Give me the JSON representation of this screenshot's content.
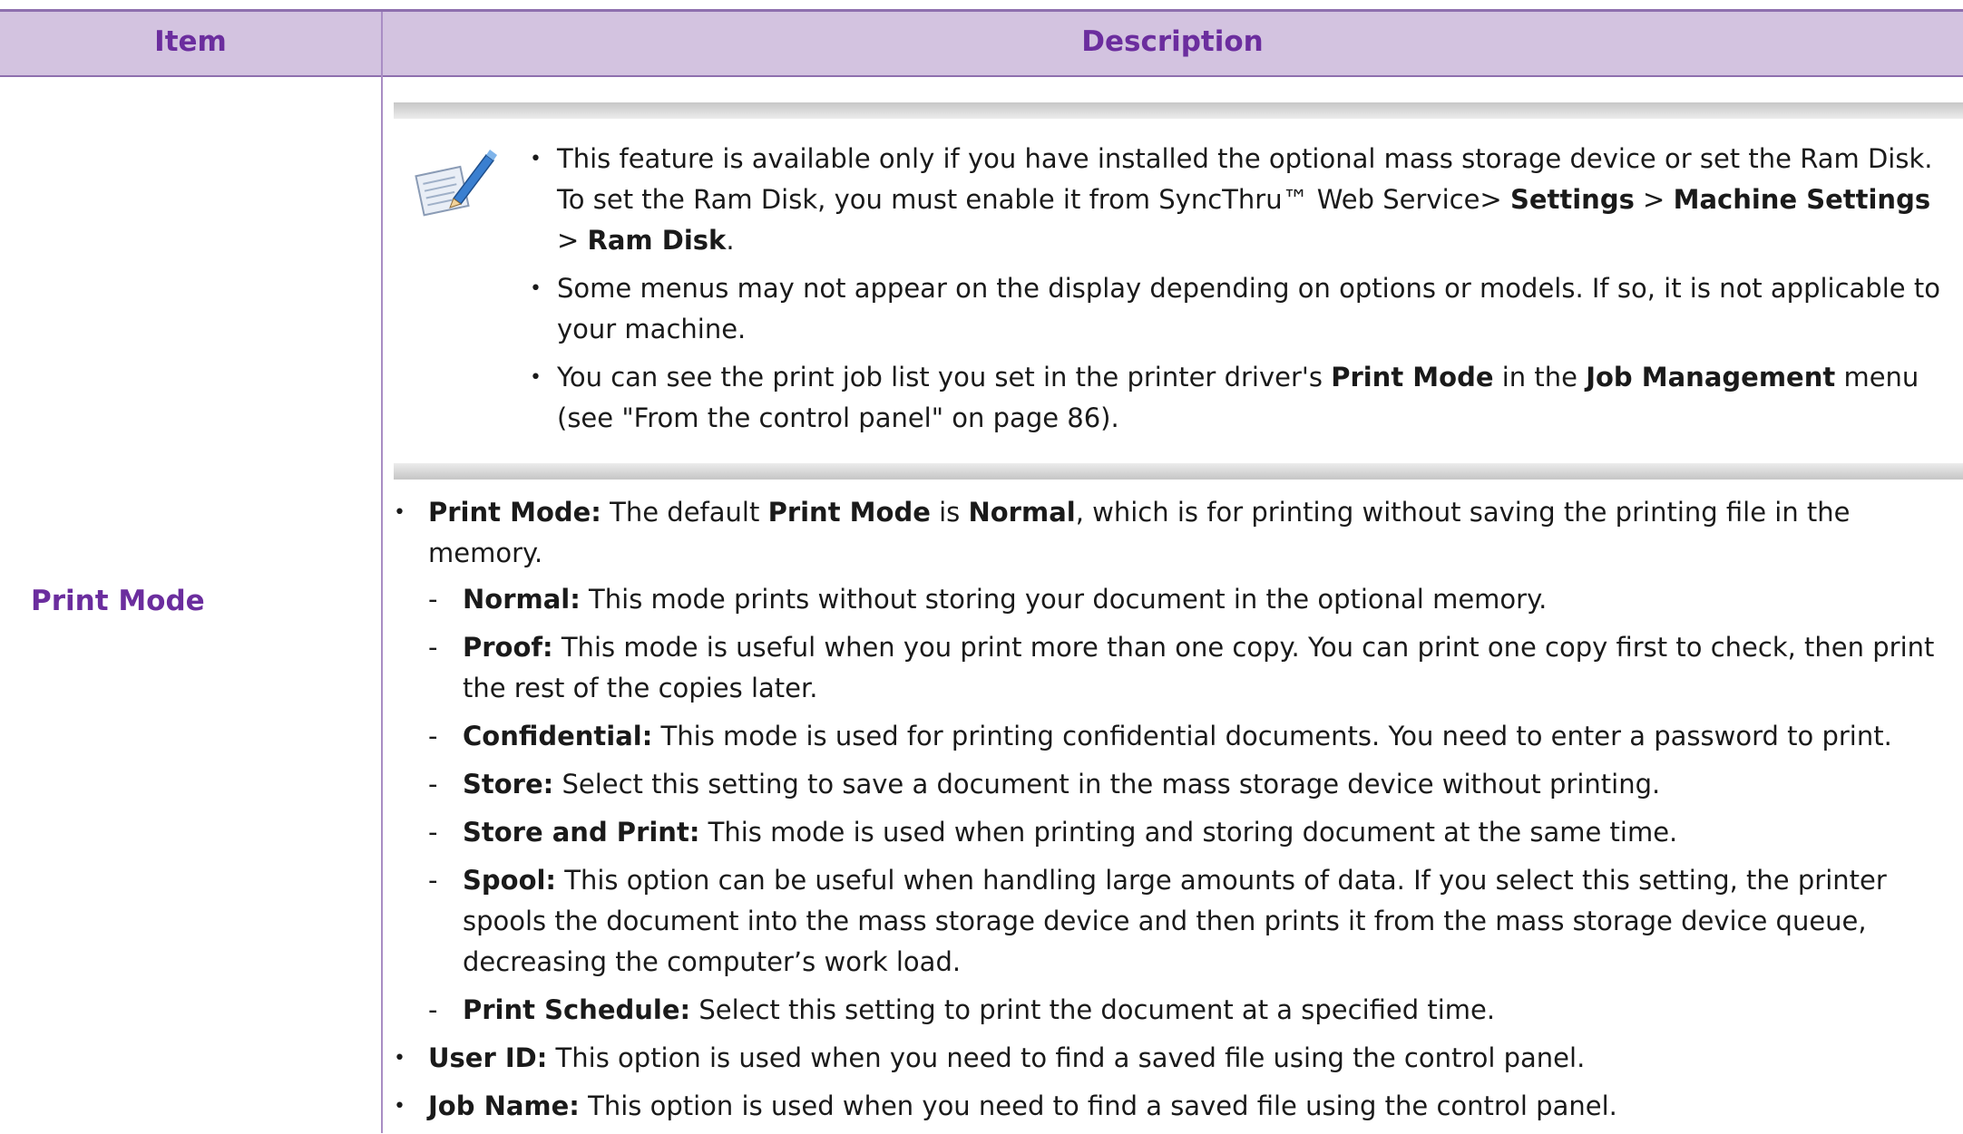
{
  "header": {
    "item": "Item",
    "description": "Description"
  },
  "row": {
    "item_label": "Print Mode"
  },
  "note": {
    "icon": "note-pencil-icon",
    "items": [
      {
        "t1": " This feature is available only if you have installed the optional mass storage device or set the Ram Disk. To set the Ram Disk, you must enable it from SyncThru™ Web Service",
        "sep1": "> ",
        "b1": "Settings",
        "sep2": " > ",
        "b2": "Machine Settings",
        "sep3": " > ",
        "b3": "Ram Disk",
        "t2": "."
      },
      {
        "t1": "Some menus may not appear on the display depending on options or models. If so, it is not applicable to your machine."
      },
      {
        "t1": "You can see the print job list you set in the printer driver's ",
        "b1": "Print Mode",
        "t2": " in the ",
        "b2": "Job Management",
        "t3": " menu (see \"From the control panel\" on page 86)."
      }
    ]
  },
  "main": {
    "print_mode": {
      "b1": "Print Mode:",
      "t1": " The default ",
      "b2": "Print Mode",
      "t2": " is ",
      "b3": "Normal",
      "t3": ", which is for printing without saving the printing file in the memory."
    },
    "sub": [
      {
        "b": "Normal:",
        "t": " This mode prints without storing your document in the optional memory."
      },
      {
        "b": "Proof:",
        "t": " This mode is useful when you print more than one copy. You can print one copy first to check, then print the rest of the copies later."
      },
      {
        "b": "Confidential:",
        "t": " This mode is used for printing confidential documents. You need to enter a password to print."
      },
      {
        "b": "Store:",
        "t": " Select this setting to save a document in the mass storage device without printing."
      },
      {
        "b": "Store and Print:",
        "t": " This mode is used when printing and storing document at the same time."
      },
      {
        "b": "Spool:",
        "t": " This option can be useful when handling large amounts of data. If you select this setting, the printer spools the document into the mass storage device and then prints it from the mass storage device queue, decreasing the computer’s work load."
      },
      {
        "b": "Print Schedule:",
        "t": " Select this setting to print the document at a specified time."
      }
    ],
    "user_id": {
      "b": "User ID:",
      "t": " This option is used when you need to find a saved file using the control panel."
    },
    "job_name": {
      "b": "Job Name:",
      "t": " This option is used when you need to find a saved file using the control panel."
    }
  },
  "colors": {
    "header_bg": "#d3c3e0",
    "accent": "#6b2d9e",
    "rule": "#8e6fae"
  }
}
